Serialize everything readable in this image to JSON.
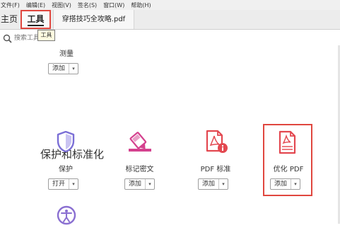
{
  "menubar": {
    "items": [
      "文件(F)",
      "编辑(E)",
      "视图(V)",
      "签名(S)",
      "窗口(W)",
      "帮助(H)"
    ]
  },
  "tabs": {
    "home": "主页",
    "tools": "工具",
    "document": "穿搭技巧全攻略.pdf"
  },
  "tooltip": "工具",
  "search": {
    "placeholder": "搜索工具"
  },
  "tools_top": [
    {
      "label": "测量",
      "button": "添加"
    }
  ],
  "section": {
    "title": "保护和标准化",
    "tools": [
      {
        "label": "保护",
        "button": "打开"
      },
      {
        "label": "标记密文",
        "button": "添加"
      },
      {
        "label": "PDF 标准",
        "button": "添加"
      },
      {
        "label": "优化 PDF",
        "button": "添加"
      }
    ]
  },
  "colors": {
    "accent_red": "#e0473f",
    "protect_purple": "#7b6fd6",
    "redact_pink": "#d4418e",
    "pdf_red": "#e34850",
    "access_purple": "#8a6fd1"
  },
  "icons": [
    "search-icon",
    "shield-icon",
    "redact-marker-icon",
    "pdf-standard-icon",
    "optimize-pdf-icon",
    "accessibility-icon"
  ]
}
